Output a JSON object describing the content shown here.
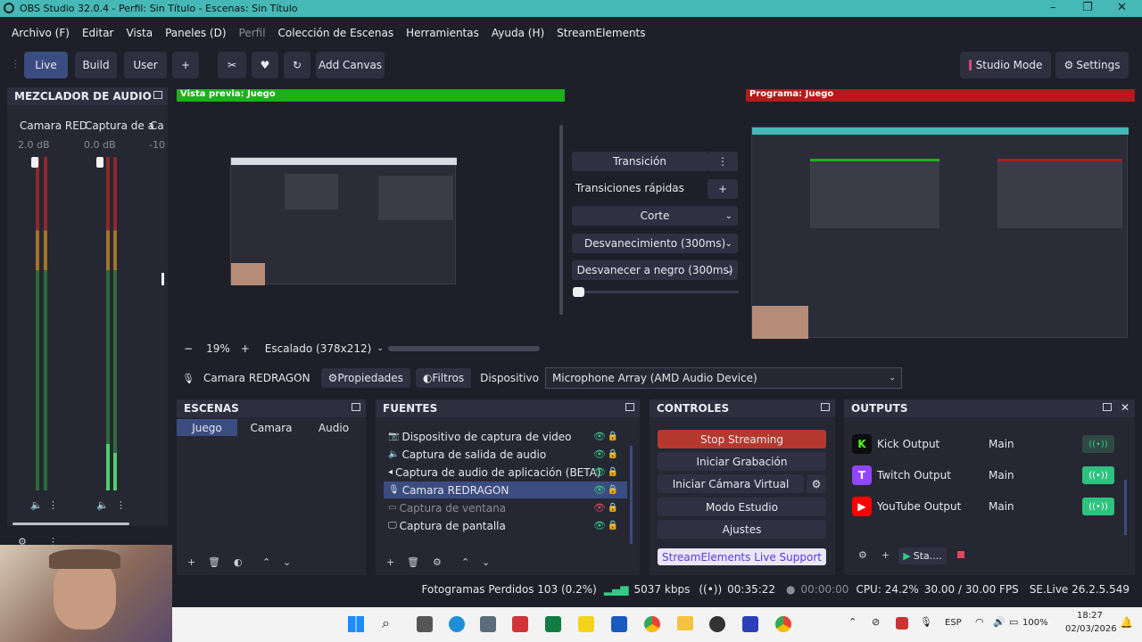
{
  "window": {
    "title": "OBS Studio 32.0.4 - Perfil: Sin Título - Escenas: Sin Título"
  },
  "menu": [
    "Archivo (F)",
    "Editar",
    "Vista",
    "Paneles (D)",
    "Perfil",
    "Colección de Escenas",
    "Herramientas",
    "Ayuda (H)",
    "StreamElements"
  ],
  "toolbar": {
    "live": "Live",
    "build": "Build",
    "user": "User",
    "plus": "+",
    "add_canvas": "Add Canvas",
    "studio_mode": "Studio Mode",
    "settings": "Settings"
  },
  "mixer": {
    "title": "MEZCLADOR DE AUDIO",
    "channels": [
      {
        "name": "Camara RED",
        "db": "2.0 dB",
        "level": 0.2
      },
      {
        "name": "Captura de a",
        "db": "0.0 dB",
        "level": 0.12
      },
      {
        "name": "Ca",
        "db": "-10",
        "level": 0
      }
    ]
  },
  "preview": {
    "label": "Vista previa: Juego",
    "zoom": "19%",
    "scale": "Escalado (378x212)"
  },
  "program": {
    "label": "Programa: Juego"
  },
  "transitions": {
    "transition": "Transición",
    "quick": "Transiciones rápidas",
    "items": [
      "Corte",
      "Desvanecimiento (300ms)",
      "Desvanecer a negro (300ms)"
    ]
  },
  "source_bar": {
    "source": "Camara REDRAGON",
    "properties": "Propiedades",
    "filters": "Filtros",
    "device_label": "Dispositivo",
    "device_value": "Microphone Array (AMD Audio Device)"
  },
  "scenes": {
    "title": "ESCENAS",
    "items": [
      "Juego",
      "Camara",
      "Audio"
    ]
  },
  "sources": {
    "title": "FUENTES",
    "items": [
      "Dispositivo de captura de video",
      "Captura de salida de audio",
      "Captura de audio de aplicación (BETA)",
      "Camara REDRAGON",
      "Captura de ventana",
      "Captura de pantalla"
    ]
  },
  "controls": {
    "title": "CONTROLES",
    "stop_streaming": "Stop Streaming",
    "start_recording": "Iniciar Grabación",
    "virtual_cam": "Iniciar Cámara Virtual",
    "studio_mode": "Modo Estudio",
    "settings": "Ajustes",
    "support": "StreamElements Live Support"
  },
  "outputs": {
    "title": "OUTPUTS",
    "rows": [
      {
        "name": "Kick Output",
        "target": "Main",
        "color": "#53fc18"
      },
      {
        "name": "Twitch Output",
        "target": "Main",
        "color": "#9146ff"
      },
      {
        "name": "YouTube Output",
        "target": "Main",
        "color": "#ff0000"
      }
    ],
    "start": "Sta...."
  },
  "status": {
    "dropped": "Fotogramas Perdidos 103 (0.2%)",
    "bitrate": "5037 kbps",
    "stream_time": "00:35:22",
    "rec_time": "00:00:00",
    "cpu": "CPU: 24.2%",
    "fps": "30.00 / 30.00 FPS",
    "version": "SE.Live 26.2.5.549"
  },
  "taskbar": {
    "lang": "ESP",
    "battery": "100%",
    "time": "18:27",
    "date": "02/03/2026"
  }
}
